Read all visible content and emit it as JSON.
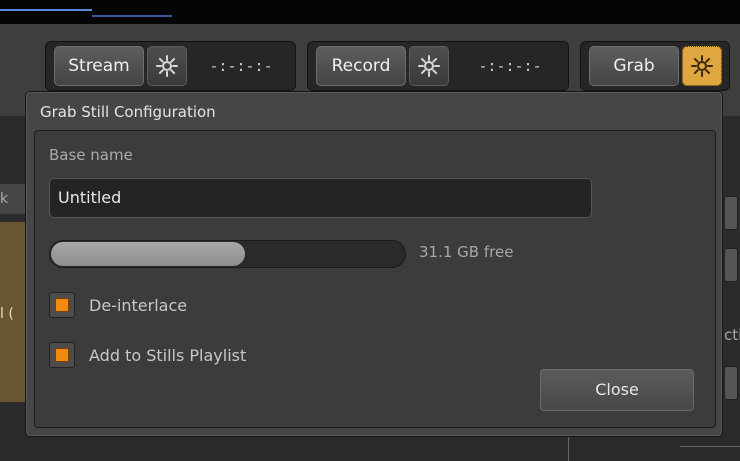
{
  "toolbar": {
    "stream": {
      "label": "Stream",
      "timecode": "-:-:-:-"
    },
    "record": {
      "label": "Record",
      "timecode": "-:-:-:-"
    },
    "grab": {
      "label": "Grab"
    },
    "gear_icon": "gear-icon",
    "gear_active_color": "#e0a640"
  },
  "dialog": {
    "title": "Grab Still Configuration",
    "base_name_label": "Base name",
    "base_name_value": "Untitled",
    "disk": {
      "used_fraction": 0.55,
      "free_text": "31.1 GB free"
    },
    "deinterlace": {
      "label": "De-interlace",
      "checked": true
    },
    "add_playlist": {
      "label": "Add to Stills Playlist",
      "checked": true
    },
    "close_label": "Close"
  },
  "background": {
    "left_tab_text": "k",
    "left_tab2_text": "l (",
    "right_text": "cti"
  },
  "colors": {
    "accent": "#f28a10",
    "panel": "#3c3c3c"
  }
}
